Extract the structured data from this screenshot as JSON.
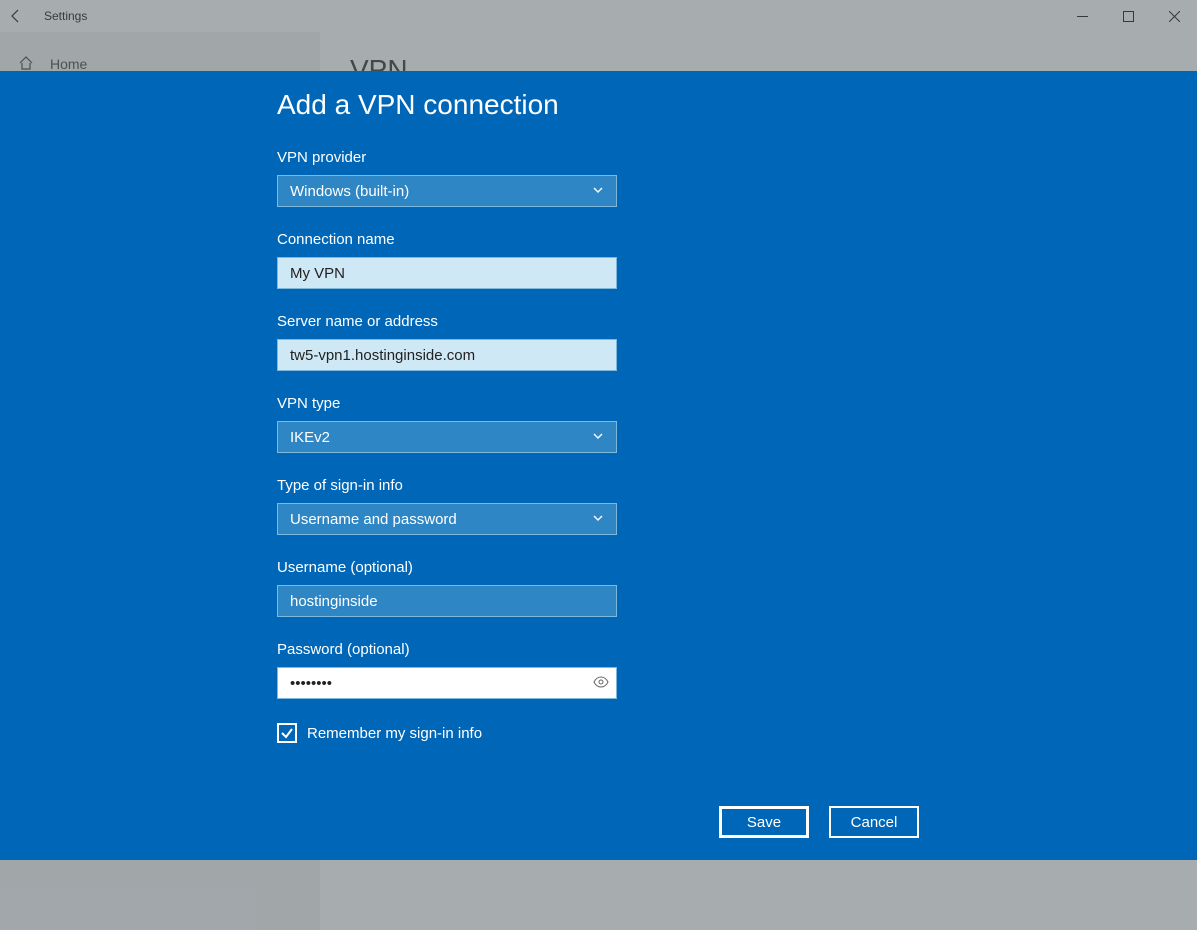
{
  "background": {
    "app_title": "Settings",
    "home_label": "Home",
    "main_heading": "VPN"
  },
  "modal": {
    "title": "Add a VPN connection",
    "fields": {
      "provider": {
        "label": "VPN provider",
        "value": "Windows (built-in)"
      },
      "connection_name": {
        "label": "Connection name",
        "value": "My VPN"
      },
      "server": {
        "label": "Server name or address",
        "value": "tw5-vpn1.hostinginside.com"
      },
      "vpn_type": {
        "label": "VPN type",
        "value": "IKEv2"
      },
      "signin_type": {
        "label": "Type of sign-in info",
        "value": "Username and password"
      },
      "username": {
        "label": "Username (optional)",
        "value": "hostinginside"
      },
      "password": {
        "label": "Password (optional)",
        "value": "••••••••"
      }
    },
    "remember_label": "Remember my sign-in info",
    "remember_checked": true,
    "buttons": {
      "save": "Save",
      "cancel": "Cancel"
    }
  }
}
